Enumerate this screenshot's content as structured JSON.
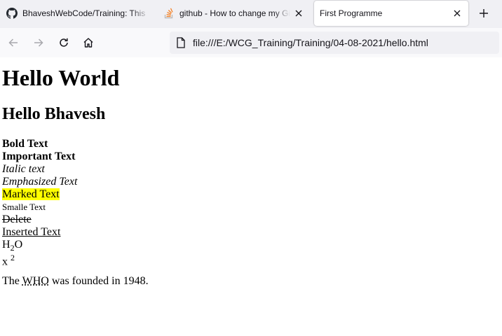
{
  "browser": {
    "tabs": [
      {
        "title": "BhaveshWebCode/Training: This",
        "icon": "github-icon",
        "active": false
      },
      {
        "title": "github - How to change my Git",
        "icon": "stackoverflow-icon",
        "active": false
      },
      {
        "title": "First Programme",
        "icon": "",
        "active": true
      }
    ],
    "address": "file:///E:/WCG_Training/Training/04-08-2021/hello.html"
  },
  "page": {
    "h1": "Hello World",
    "h2": "Hello Bhavesh",
    "bold": "Bold Text",
    "strong": "Important Text",
    "italic": "Italic text",
    "emphasized": "Emphasized Text",
    "marked": "Marked Text",
    "small": "Smalle Text",
    "deleted": "Delete",
    "inserted": "Inserted Text",
    "h2o": {
      "base": "H",
      "sub": "2",
      "rest": "O"
    },
    "x2": {
      "base": "x ",
      "sup": "2"
    },
    "who": {
      "before": "The ",
      "abbr": "WHO",
      "after": " was founded in 1948."
    }
  }
}
